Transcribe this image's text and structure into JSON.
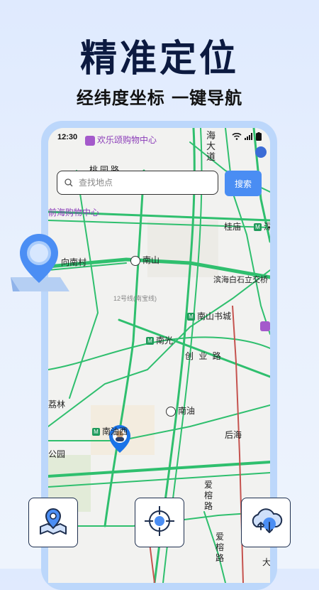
{
  "headline": "精准定位",
  "subheadline": "经纬度坐标 一键导航",
  "status_bar": {
    "time": "12:30"
  },
  "search": {
    "placeholder": "查找地点",
    "button_label": "搜索"
  },
  "map_labels": {
    "mall_top": "欢乐颂购物中心",
    "hai": "海",
    "da": "大",
    "dao": "道",
    "taoyuan_road": "桃园路",
    "qianhai_mall": "前海购物中心",
    "guimiao": "桂庙",
    "shen": "深",
    "xiangnancun": "向南村",
    "nanshan": "南山",
    "binhai_bridge": "滨海白石立交桥",
    "line12": "12号线(南宝线)",
    "nanshan_bookcity": "南山书城",
    "nanguang": "南光",
    "chuangye_road": "创 业 路",
    "lilin": "荔林",
    "nanyou": "南油",
    "nanyouxi": "南油西",
    "houhai": "后海",
    "park": "公园",
    "aiyu_road1": "爱榕路",
    "aiyu_road2": "爱榕路",
    "da2": "大"
  },
  "bottom_actions": [
    {
      "name": "map-location"
    },
    {
      "name": "crosshair-locate"
    },
    {
      "name": "cloud-sync"
    }
  ],
  "colors": {
    "accent": "#4a8df3",
    "road": "#2fbf6e",
    "headline": "#0c1a40"
  }
}
